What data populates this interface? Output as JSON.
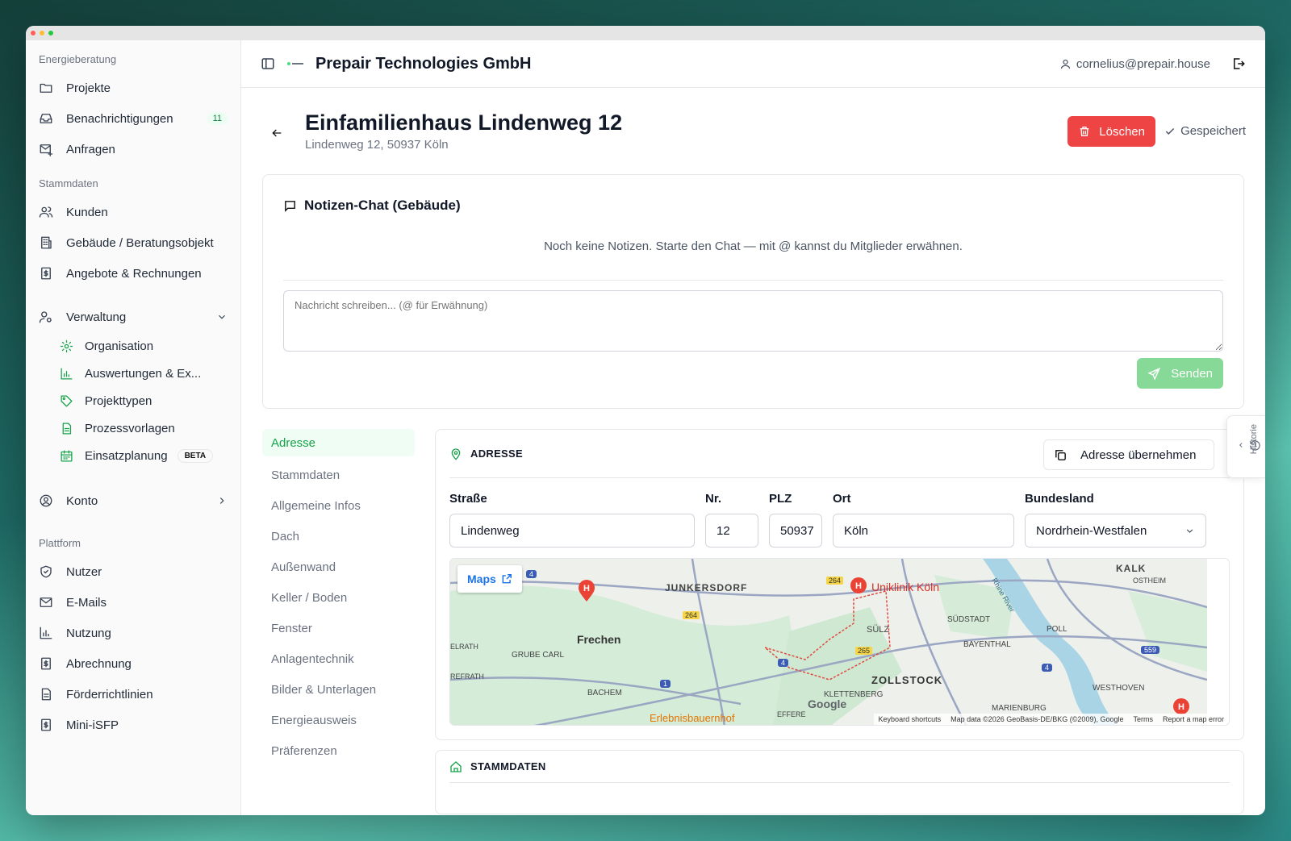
{
  "sidebar": {
    "sections": [
      {
        "title": "Energieberatung",
        "items": [
          {
            "label": "Projekte",
            "icon": "folder-icon"
          },
          {
            "label": "Benachrichtigungen",
            "icon": "inbox-icon",
            "badge": "11"
          },
          {
            "label": "Anfragen",
            "icon": "mail-plus-icon"
          }
        ]
      },
      {
        "title": "Stammdaten",
        "items": [
          {
            "label": "Kunden",
            "icon": "users-icon"
          },
          {
            "label": "Gebäude / Beratungsobjekt",
            "icon": "building-icon"
          },
          {
            "label": "Angebote & Rechnungen",
            "icon": "invoice-icon"
          }
        ]
      }
    ],
    "verwaltung": {
      "label": "Verwaltung",
      "sub": [
        {
          "label": "Organisation",
          "icon": "gear-icon"
        },
        {
          "label": "Auswertungen & Ex...",
          "icon": "bar-chart-icon"
        },
        {
          "label": "Projekttypen",
          "icon": "tag-icon"
        },
        {
          "label": "Prozessvorlagen",
          "icon": "file-icon"
        },
        {
          "label": "Einsatzplanung",
          "icon": "calendar-icon",
          "badge": "BETA"
        }
      ]
    },
    "konto": "Konto",
    "plattform": {
      "title": "Plattform",
      "items": [
        {
          "label": "Nutzer",
          "icon": "shield-icon"
        },
        {
          "label": "E-Mails",
          "icon": "mail-icon"
        },
        {
          "label": "Nutzung",
          "icon": "bar-chart-icon"
        },
        {
          "label": "Abrechnung",
          "icon": "invoice-icon"
        },
        {
          "label": "Förderrichtlinien",
          "icon": "file-icon"
        },
        {
          "label": "Mini-iSFP",
          "icon": "invoice-icon"
        }
      ]
    }
  },
  "topbar": {
    "company": "Prepair Technologies GmbH",
    "user": "cornelius@prepair.house"
  },
  "header": {
    "title": "Einfamilienhaus Lindenweg 12",
    "subtitle": "Lindenweg 12, 50937 Köln",
    "delete_label": "Löschen",
    "saved_label": "Gespeichert"
  },
  "chat": {
    "title": "Notizen-Chat (Gebäude)",
    "empty": "Noch keine Notizen. Starte den Chat — mit @ kannst du Mitglieder erwähnen.",
    "placeholder": "Nachricht schreiben... (@ für Erwähnung)",
    "send_label": "Senden"
  },
  "subnav": [
    "Adresse",
    "Stammdaten",
    "Allgemeine Infos",
    "Dach",
    "Außenwand",
    "Keller / Boden",
    "Fenster",
    "Anlagentechnik",
    "Bilder & Unterlagen",
    "Energieausweis",
    "Präferenzen"
  ],
  "address": {
    "heading": "ADRESSE",
    "copy_label": "Adresse übernehmen",
    "labels": {
      "street": "Straße",
      "nr": "Nr.",
      "plz": "PLZ",
      "ort": "Ort",
      "state": "Bundesland"
    },
    "values": {
      "street": "Lindenweg",
      "nr": "12",
      "plz": "50937",
      "ort": "Köln",
      "state": "Nordrhein-Westfalen"
    }
  },
  "map": {
    "maps_label": "Maps",
    "places": [
      "Frechen",
      "JUNKERSDORF",
      "Uniklinik Köln",
      "SÜLZ",
      "SÜDSTADT",
      "KALK",
      "OSTHEIM",
      "POLL",
      "BAYENTHAL",
      "ZOLLSTOCK",
      "GRUBE CARL",
      "BACHEM",
      "KLETTENBERG",
      "WESTHOVEN",
      "MARIENBURG",
      "Erlebnisbauernhof",
      "ELRATH",
      "REFRATH",
      "EFFERE",
      "Rhine River"
    ],
    "roads": [
      "4",
      "264",
      "264",
      "265",
      "4",
      "1",
      "4",
      "559"
    ],
    "footer": [
      "Keyboard shortcuts",
      "Map data ©2026 GeoBasis-DE/BKG (©2009), Google",
      "Terms",
      "Report a map error"
    ],
    "logo": "Google"
  },
  "stammdaten_heading": "STAMMDATEN",
  "historie": "Historie",
  "colors": {
    "accent": "#16a34a",
    "danger": "#ef4444"
  }
}
